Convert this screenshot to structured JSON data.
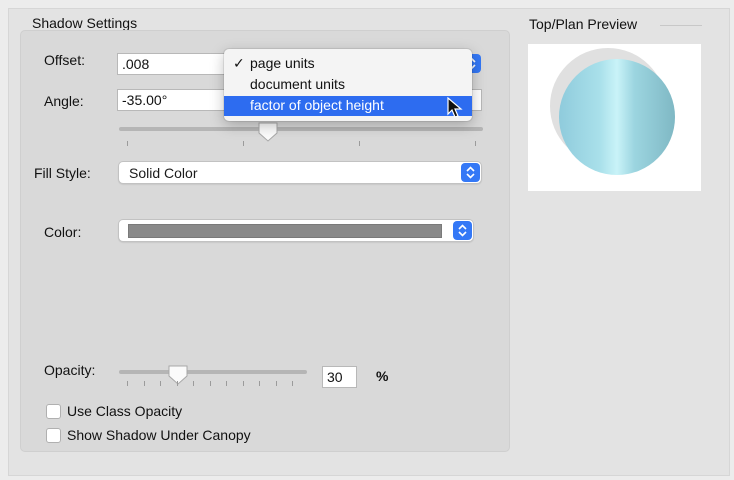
{
  "shadow_section": {
    "title": "Shadow Settings"
  },
  "preview_section": {
    "title": "Top/Plan Preview"
  },
  "offset": {
    "label": "Offset:",
    "value": ".008"
  },
  "angle": {
    "label": "Angle:",
    "value": "-35.00°",
    "slider_fraction": 0.41
  },
  "units_menu": {
    "items": [
      {
        "label": "page units",
        "checked": true
      },
      {
        "label": "document units",
        "checked": false
      },
      {
        "label": "factor of object height",
        "checked": false,
        "highlighted": true
      }
    ]
  },
  "fill_style": {
    "label": "Fill Style:",
    "value": "Solid Color"
  },
  "color": {
    "label": "Color:",
    "swatch": "#8a8a8a"
  },
  "opacity": {
    "label": "Opacity:",
    "value": "30",
    "unit": "%",
    "slider_fraction": 0.3
  },
  "checkboxes": [
    {
      "label": "Use Class Opacity",
      "checked": false
    },
    {
      "label": "Show Shadow Under Canopy",
      "checked": false
    }
  ],
  "colors": {
    "accent": "#3478f6",
    "highlight": "#2d6cf0",
    "preview_disc": "#9bd8e3"
  },
  "icons": {
    "stepper": "up-down-chevron-icon",
    "checkmark": "checkmark-icon",
    "cursor": "arrow-cursor-icon"
  }
}
